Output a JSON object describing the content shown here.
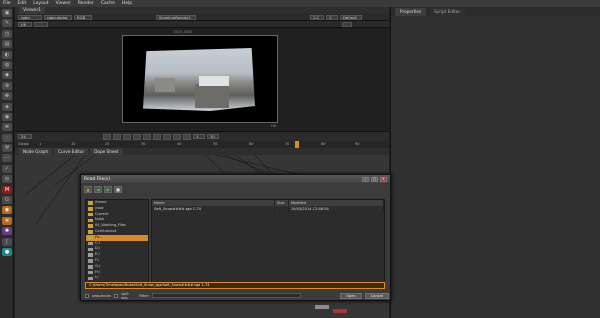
{
  "menu": [
    "File",
    "Edit",
    "Layout",
    "Viewer",
    "Render",
    "Cache",
    "Help"
  ],
  "viewer": {
    "tab": "Viewer1",
    "channels": "rgba",
    "layer": "rgba.alpha",
    "color": "RGB",
    "input": "ScanlineRender1",
    "zoom": "1:1",
    "gain": "f/8",
    "frame": "1",
    "view": "Default",
    "frame_label": "1920,1080",
    "format_label": "HD",
    "info_left": "HD 1920x1080 bbox: 0 0 1920 1080 channels: rgba,depth,forward.u,forward.v",
    "info_mid": "x= 452 y= -44"
  },
  "timeline": {
    "fps": "24",
    "global": "Global",
    "ticks": [
      "1",
      "10",
      "20",
      "30",
      "40",
      "50",
      "60",
      "70",
      "80",
      "90",
      "100"
    ],
    "frame_field": "1",
    "step": "10"
  },
  "nodegraph_tabs": [
    "Node Graph",
    "Curve Editor",
    "Dope Sheet"
  ],
  "right_tabs": [
    "Properties",
    "Script Editor"
  ],
  "dialog": {
    "title": "Read File(s)",
    "close_label": "X",
    "sidebar": [
      {
        "label": "/home",
        "type": "folder"
      },
      {
        "label": "/root",
        "type": "folder"
      },
      {
        "label": "Current",
        "type": "folder"
      },
      {
        "label": "Nuke",
        "type": "folder"
      },
      {
        "label": "04_Working_Files",
        "type": "folder"
      },
      {
        "label": "Camtracks4",
        "type": "folder"
      },
      {
        "label": "Fa...",
        "type": "folder",
        "selected": true
      },
      {
        "label": "C:/",
        "type": "drive"
      },
      {
        "label": "D:/",
        "type": "drive"
      },
      {
        "label": "E:/",
        "type": "drive"
      },
      {
        "label": "F:/",
        "type": "drive"
      },
      {
        "label": "G:/",
        "type": "drive"
      },
      {
        "label": "H:/",
        "type": "drive"
      },
      {
        "label": "I:/",
        "type": "drive"
      },
      {
        "label": "J:/",
        "type": "drive"
      },
      {
        "label": "K:/",
        "type": "drive"
      }
    ],
    "sidebar_buttons": [
      "+",
      "edit",
      "-"
    ],
    "columns": [
      "Name",
      "Size",
      "Modified"
    ],
    "files": [
      {
        "name": "Soft_Snow####.tga 1-74",
        "size": "",
        "modified": "19/03/2014 12:48:54"
      }
    ],
    "path": "C:/Users/Timelapse/Nuke/Soft_Snow_tga/Soft_Snow####.tga 1-74",
    "sequences_label": "sequences",
    "splitseq_label": "split seq",
    "filter_label": "Filter:",
    "buttons": [
      "Open",
      "Cancel"
    ]
  }
}
